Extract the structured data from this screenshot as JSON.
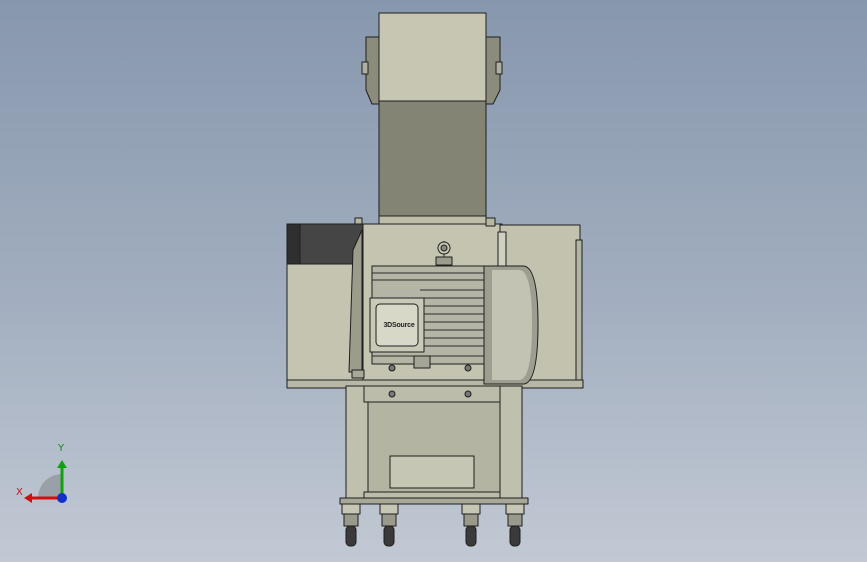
{
  "model_view": {
    "nameplate_text": "3DSource",
    "colors": {
      "background_top": "#8797ad",
      "background_bottom": "#c2c9d4",
      "body": "#c4c4b1",
      "body_shade": "#9b9b8a",
      "hopper_dark": "#7f8070",
      "motor": "#b2b2a2",
      "panel_dark": "#454545",
      "outline": "#1e1e1e"
    }
  },
  "triad": {
    "x_label": "X",
    "y_label": "Y",
    "colors": {
      "x": "#d01010",
      "y": "#10a010",
      "z": "#1030c8"
    }
  }
}
